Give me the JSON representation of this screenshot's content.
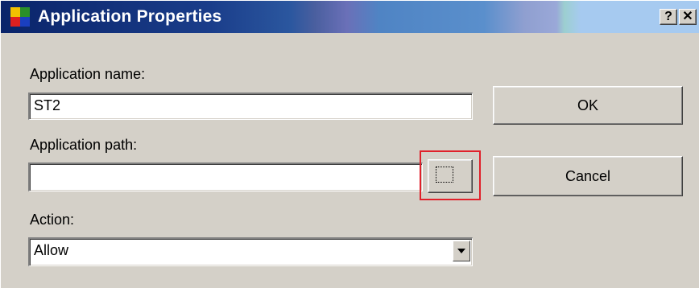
{
  "window": {
    "title": "Application Properties",
    "help_button": "?",
    "close_button": "✕"
  },
  "form": {
    "app_name_label": "Application name:",
    "app_name_value": "ST2",
    "app_path_label": "Application path:",
    "app_path_value": "",
    "browse_button": "...",
    "action_label": "Action:",
    "action_value": "Allow"
  },
  "buttons": {
    "ok": "OK",
    "cancel": "Cancel"
  },
  "colors": {
    "titlebar_start": "#0a246a",
    "titlebar_end": "#a6caf0",
    "highlight": "#e0202a"
  }
}
